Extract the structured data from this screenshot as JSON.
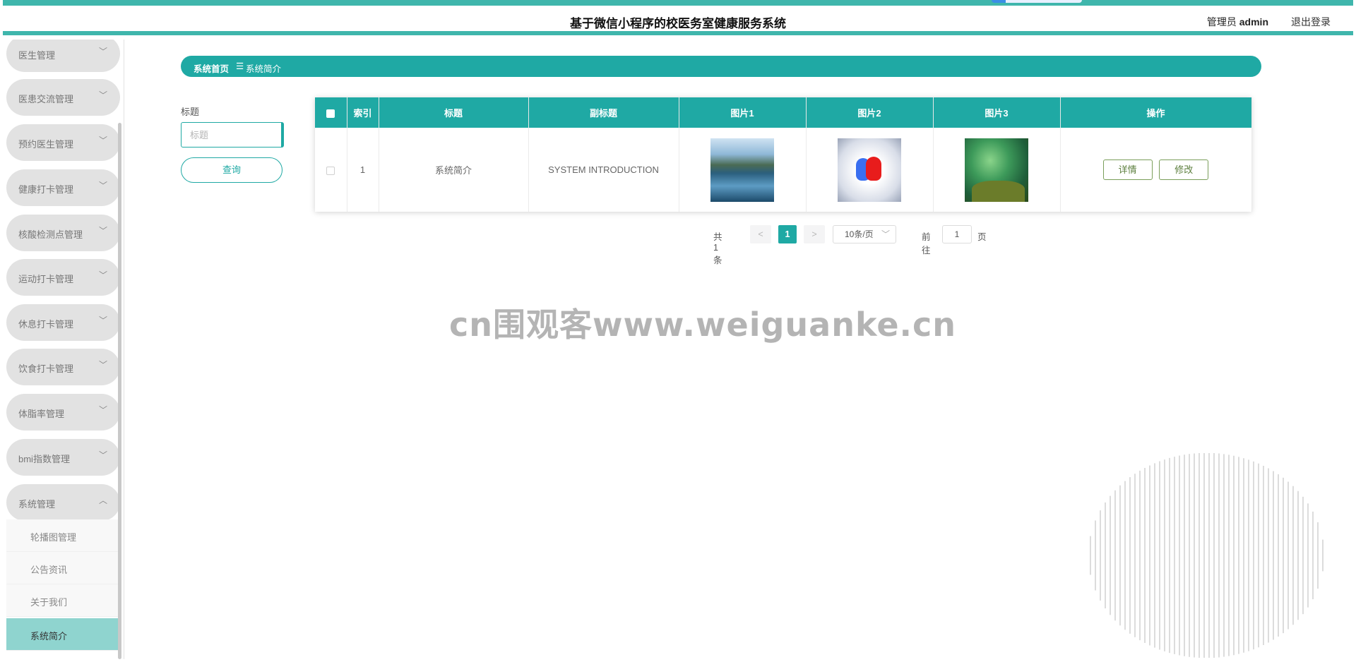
{
  "header": {
    "title": "基于微信小程序的校医务室健康服务系统",
    "user_prefix": "管理员",
    "user_name": "admin",
    "logout": "退出登录"
  },
  "sidebar": {
    "menus": [
      {
        "label": "医生管理",
        "expanded": false
      },
      {
        "label": "医患交流管理",
        "expanded": false
      },
      {
        "label": "预约医生管理",
        "expanded": false
      },
      {
        "label": "健康打卡管理",
        "expanded": false
      },
      {
        "label": "核酸检测点管理",
        "expanded": false
      },
      {
        "label": "运动打卡管理",
        "expanded": false
      },
      {
        "label": "休息打卡管理",
        "expanded": false
      },
      {
        "label": "饮食打卡管理",
        "expanded": false
      },
      {
        "label": "体脂率管理",
        "expanded": false
      },
      {
        "label": "bmi指数管理",
        "expanded": false
      },
      {
        "label": "系统管理",
        "expanded": true
      }
    ],
    "submenu": [
      {
        "label": "轮播图管理",
        "active": false
      },
      {
        "label": "公告资讯",
        "active": false
      },
      {
        "label": "关于我们",
        "active": false
      },
      {
        "label": "系统简介",
        "active": true
      }
    ]
  },
  "breadcrumb": {
    "home": "系统首页",
    "separator": "☰",
    "current": "系统简介"
  },
  "search": {
    "label": "标题",
    "placeholder": "标题",
    "value": "",
    "button": "查询"
  },
  "table": {
    "columns": [
      "索引",
      "标题",
      "副标题",
      "图片1",
      "图片2",
      "图片3",
      "操作"
    ],
    "rows": [
      {
        "index": "1",
        "title": "系统简介",
        "subtitle": "SYSTEM INTRODUCTION",
        "images": [
          "lake-mountain-image",
          "heart-balloons-image",
          "moss-plant-image"
        ],
        "actions": [
          "详情",
          "修改"
        ]
      }
    ]
  },
  "pagination": {
    "total": "共 1 条",
    "prev": "<",
    "next": ">",
    "current_page": "1",
    "page_size": "10条/页",
    "goto_prefix": "前往",
    "goto_value": "1",
    "goto_suffix": "页"
  },
  "watermark": "cn围观客www.weiguanke.cn",
  "colors": {
    "primary": "#1fa9a4",
    "stripe": "#3fb6ac",
    "active_submenu": "#8fd4cf",
    "menu_bg": "#e2e2e2",
    "action_border": "#7a9e5a"
  }
}
